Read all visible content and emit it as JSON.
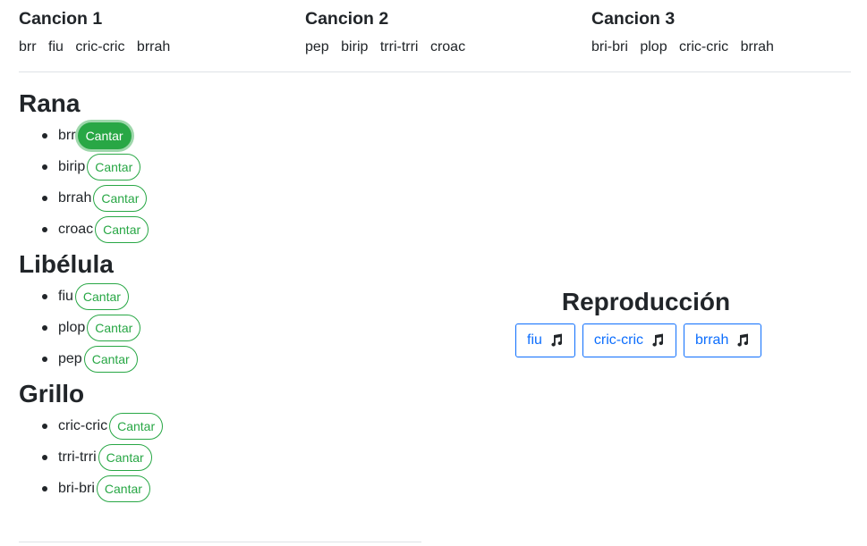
{
  "songs": [
    {
      "title": "Cancion 1",
      "sounds": [
        "brr",
        "fiu",
        "cric-cric",
        "brrah"
      ]
    },
    {
      "title": "Cancion 2",
      "sounds": [
        "pep",
        "birip",
        "trri-trri",
        "croac"
      ]
    },
    {
      "title": "Cancion 3",
      "sounds": [
        "bri-bri",
        "plop",
        "cric-cric",
        "brrah"
      ]
    }
  ],
  "animals": [
    {
      "name": "Rana",
      "sounds": [
        "brr",
        "birip",
        "brrah",
        "croac"
      ]
    },
    {
      "name": "Libélula",
      "sounds": [
        "fiu",
        "plop",
        "pep"
      ]
    },
    {
      "name": "Grillo",
      "sounds": [
        "cric-cric",
        "trri-trri",
        "bri-bri"
      ]
    }
  ],
  "sing_label": "Cantar",
  "active_sound": "brr",
  "playback": {
    "title": "Reproducción",
    "items": [
      "fiu",
      "cric-cric",
      "brrah"
    ],
    "icon": "music-note-icon"
  },
  "colors": {
    "success": "#28a745",
    "primary": "#0d6efd",
    "text": "#212529"
  }
}
